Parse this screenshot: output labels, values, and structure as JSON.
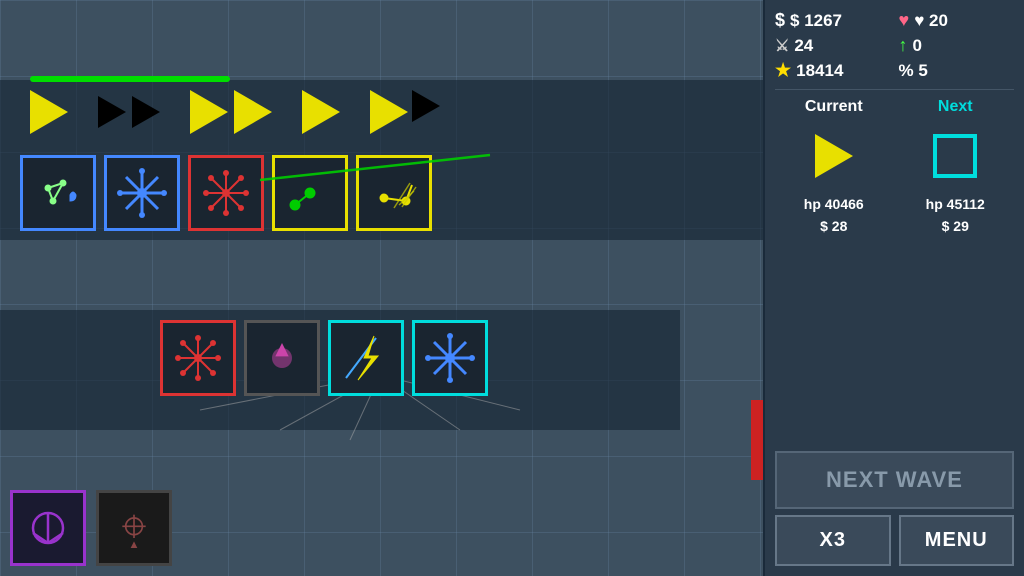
{
  "stats": {
    "money": "$ 1267",
    "health": "♥ 20",
    "sword": "24",
    "arrow": "0",
    "star": "18414",
    "percent": "% 5",
    "money_icon": "$",
    "health_icon": "♥",
    "sword_icon": "⚔",
    "arrow_icon": "↑",
    "star_icon": "★",
    "percent_icon": "%"
  },
  "current_next": {
    "current_label": "Current",
    "next_label": "Next",
    "current_hp": "hp 40466",
    "next_hp": "hp 45112",
    "current_money": "$ 28",
    "next_money": "$ 29"
  },
  "buttons": {
    "next_wave": "NEXT WAVE",
    "x3": "X3",
    "menu": "MENU"
  }
}
